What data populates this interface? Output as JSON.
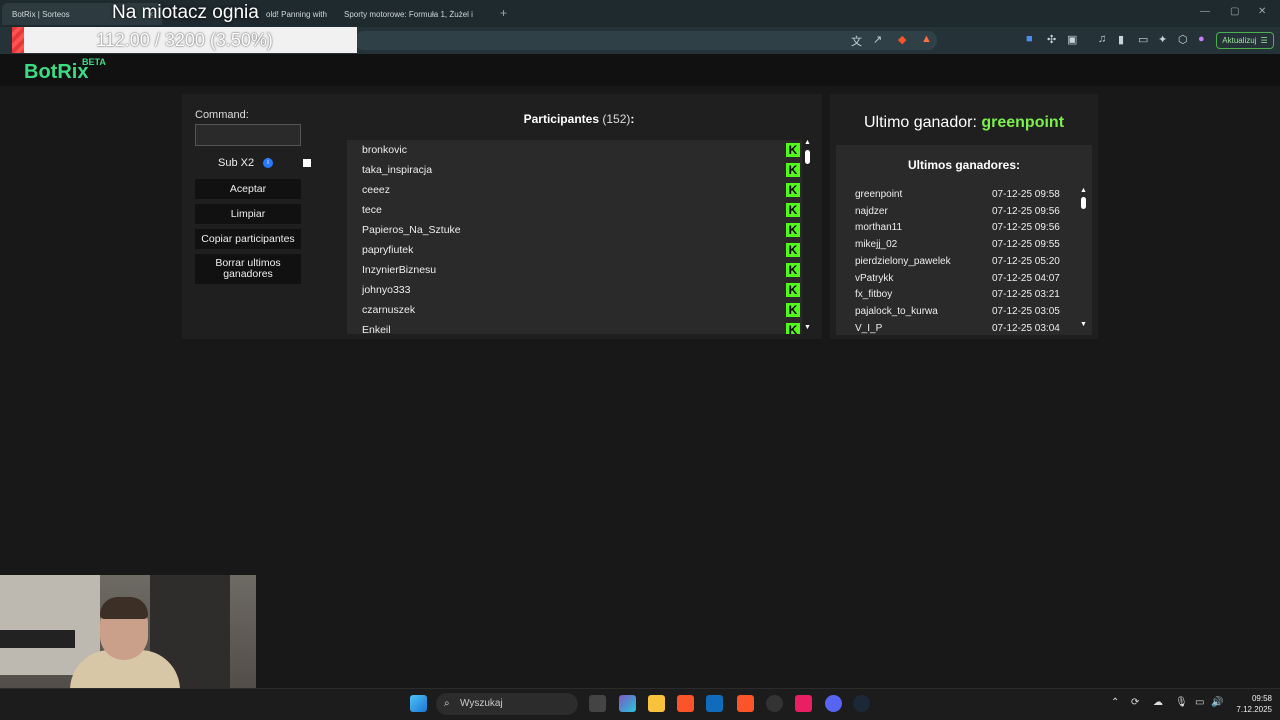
{
  "browser": {
    "tabs": [
      {
        "label": "BotRix | Sorteos",
        "active": true
      },
      {
        "label": "old! Panning with",
        "active": false
      },
      {
        "label": "Sporty motorowe: Formuła 1, Żużel i",
        "active": false
      }
    ],
    "update_label": "Aktualizuj"
  },
  "overlay": {
    "title": "Na miotacz ognia",
    "progress_text": "112.00 / 3200 (3.50%)",
    "progress_fraction": 0.035
  },
  "app": {
    "logo": "BotRix",
    "beta": "BETA"
  },
  "controls": {
    "command_label": "Command:",
    "command_value": "",
    "sub_label": "Sub X2",
    "sub_checked": false,
    "buttons": [
      "Aceptar",
      "Limpiar",
      "Copiar participantes",
      "Borrar ultimos ganadores"
    ]
  },
  "participants": {
    "title": "Participantes",
    "count": "(152)",
    "colon": ":",
    "names": [
      "bronkovic",
      "taka_inspiracja",
      "ceeez",
      "tece",
      "Papieros_Na_Sztuke",
      "papryfiutek",
      "InzynierBiznesu",
      "johnyo333",
      "czarnuszek",
      "Enkeil"
    ],
    "platform_badge": "K"
  },
  "winner": {
    "label": "Ultimo ganador:",
    "name": "greenpoint"
  },
  "last_winners": {
    "title": "Ultimos ganadores:",
    "rows": [
      {
        "name": "greenpoint",
        "date": "07-12-25 09:58"
      },
      {
        "name": "najdzer",
        "date": "07-12-25 09:56"
      },
      {
        "name": "morthan11",
        "date": "07-12-25 09:56"
      },
      {
        "name": "mikejj_02",
        "date": "07-12-25 09:55"
      },
      {
        "name": "pierdzielony_pawelek",
        "date": "07-12-25 05:20"
      },
      {
        "name": "vPatrykk",
        "date": "07-12-25 04:07"
      },
      {
        "name": "fx_fitboy",
        "date": "07-12-25 03:21"
      },
      {
        "name": "pajalock_to_kurwa",
        "date": "07-12-25 03:05"
      },
      {
        "name": "V_I_P",
        "date": "07-12-25 03:04"
      }
    ]
  },
  "taskbar": {
    "search_placeholder": "Wyszukaj",
    "time": "09:58",
    "date": "7.12.2025"
  },
  "colors": {
    "accent_green": "#3ddc84",
    "kick_green": "#53fc18",
    "progress_red": "#e53935"
  }
}
